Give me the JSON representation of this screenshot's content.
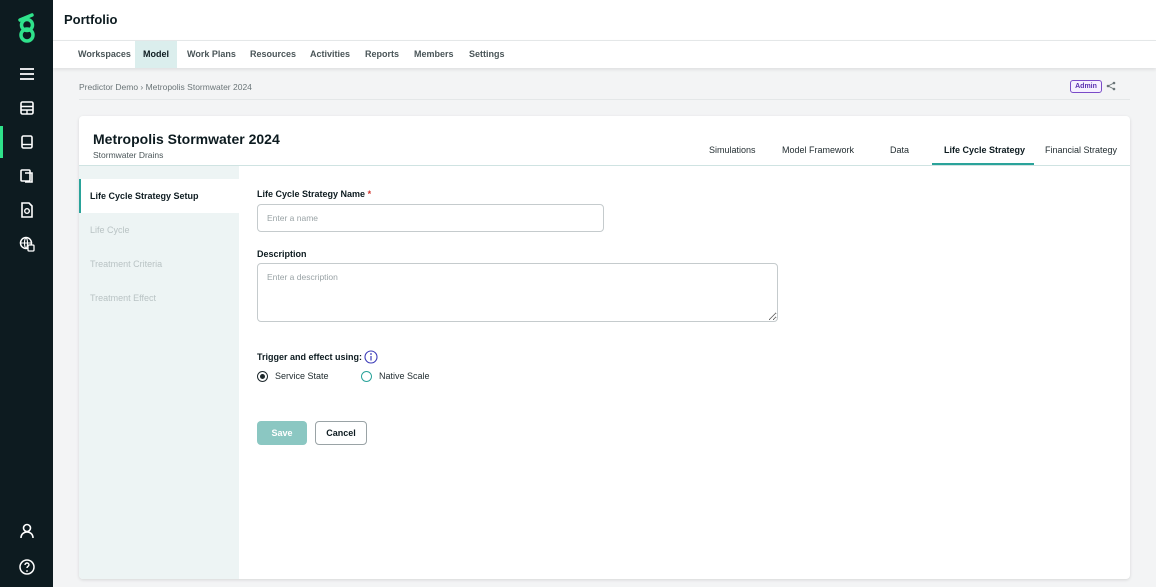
{
  "colors": {
    "rail_bg": "#0d1b20",
    "accent": "#2aa39a",
    "brand_green": "#2fe28b",
    "active_nav_bg": "#dbeeed",
    "save_button": "#8bc7c2",
    "admin_purple": "#7a4bc8",
    "required": "#d0342c"
  },
  "rail": {
    "icons": [
      "logo-icon",
      "menu-icon",
      "database-icon",
      "model-icon",
      "copy-icon",
      "document-icon",
      "global-settings-icon",
      "user-icon",
      "help-icon"
    ],
    "active": "model-icon"
  },
  "header": {
    "title": "Portfolio"
  },
  "nav": {
    "items": [
      {
        "label": "Workspaces"
      },
      {
        "label": "Model",
        "active": true
      },
      {
        "label": "Work Plans"
      },
      {
        "label": "Resources"
      },
      {
        "label": "Activities"
      },
      {
        "label": "Reports"
      },
      {
        "label": "Members"
      },
      {
        "label": "Settings"
      }
    ]
  },
  "breadcrumb": {
    "text": "Predictor Demo › Metropolis Stormwater 2024",
    "badge": "Admin"
  },
  "card": {
    "title": "Metropolis Stormwater 2024",
    "subtitle": "Stormwater Drains",
    "tabs": [
      {
        "label": "Simulations"
      },
      {
        "label": "Model Framework"
      },
      {
        "label": "Data"
      },
      {
        "label": "Life Cycle Strategy",
        "active": true
      },
      {
        "label": "Financial Strategy"
      }
    ]
  },
  "steps": [
    {
      "label": "Life Cycle Strategy Setup",
      "active": true
    },
    {
      "label": "Life Cycle"
    },
    {
      "label": "Treatment Criteria"
    },
    {
      "label": "Treatment Effect"
    }
  ],
  "form": {
    "name_label": "Life Cycle Strategy Name",
    "required_mark": "*",
    "name_value": "",
    "name_placeholder": "Enter a name",
    "description_label": "Description",
    "description_value": "",
    "description_placeholder": "Enter a description",
    "trigger_label": "Trigger and effect using:",
    "options": [
      {
        "label": "Service State",
        "selected": true
      },
      {
        "label": "Native Scale",
        "selected": false
      }
    ],
    "save_label": "Save",
    "cancel_label": "Cancel"
  }
}
